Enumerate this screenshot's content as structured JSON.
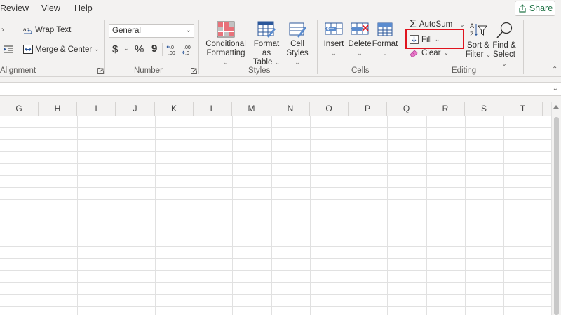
{
  "menu": {
    "tabs": [
      {
        "label": "Review"
      },
      {
        "label": "View"
      },
      {
        "label": "Help"
      }
    ],
    "share_label": "Share"
  },
  "ribbon": {
    "alignment": {
      "wrap_text": "Wrap Text",
      "merge_center": "Merge & Center",
      "group_label": "Alignment"
    },
    "number": {
      "format_value": "General",
      "currency_symbol": "$",
      "percent_symbol": "%",
      "comma_symbol": "9",
      "group_label": "Number"
    },
    "styles": {
      "conditional_formatting_l1": "Conditional",
      "conditional_formatting_l2": "Formatting",
      "format_as_table_l1": "Format as",
      "format_as_table_l2": "Table",
      "cell_styles_l1": "Cell",
      "cell_styles_l2": "Styles",
      "group_label": "Styles"
    },
    "cells": {
      "insert": "Insert",
      "delete": "Delete",
      "format": "Format",
      "group_label": "Cells"
    },
    "editing": {
      "autosum": "AutoSum",
      "fill": "Fill",
      "clear": "Clear",
      "sort_filter_l1": "Sort &",
      "sort_filter_l2": "Filter",
      "find_select_l1": "Find &",
      "find_select_l2": "Select",
      "group_label": "Editing"
    }
  },
  "sheet": {
    "columns": [
      "G",
      "H",
      "I",
      "J",
      "K",
      "L",
      "M",
      "N",
      "O",
      "P",
      "Q",
      "R",
      "S",
      "T"
    ]
  },
  "colors": {
    "highlight": "#e0141e",
    "excel_green": "#217346",
    "ribbon_bg": "#f3f2f1"
  },
  "icons": [
    "share-icon",
    "wrap-text-icon",
    "merge-center-icon",
    "indent-icon",
    "decrease-decimal-icon",
    "increase-decimal-icon",
    "conditional-formatting-icon",
    "format-as-table-icon",
    "cell-styles-icon",
    "insert-cells-icon",
    "delete-cells-icon",
    "format-cells-icon",
    "sigma-icon",
    "fill-down-icon",
    "eraser-icon",
    "sort-filter-icon",
    "search-icon"
  ]
}
